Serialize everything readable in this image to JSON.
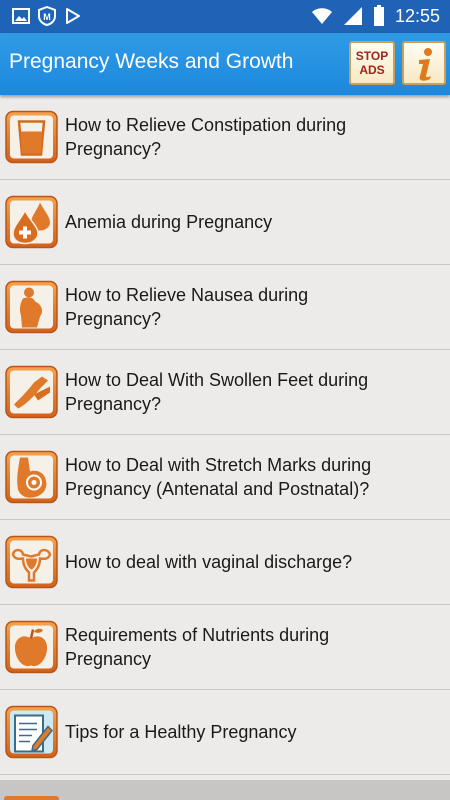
{
  "status_bar": {
    "time": "12:55",
    "left_icons": [
      "image-icon",
      "mcafee-icon",
      "play-store-icon"
    ],
    "right_icons": [
      "wifi-icon",
      "signal-icon",
      "battery-icon"
    ]
  },
  "app_bar": {
    "title": "Pregnancy Weeks and Growth",
    "stop_ads_line1": "STOP",
    "stop_ads_line2": "ADS",
    "info_icon": "info-icon"
  },
  "colors": {
    "status_bar": "#1e63b6",
    "app_bar": "#2591e0",
    "list_bg": "#ecebea",
    "icon_orange": "#e07a2a",
    "stop_ads_text": "#a3241a"
  },
  "list": {
    "items": [
      {
        "label": "How to Relieve Constipation during Pregnancy?",
        "icon": "glass-icon"
      },
      {
        "label": "Anemia during Pregnancy",
        "icon": "blood-drop-icon"
      },
      {
        "label": "How to Relieve Nausea during Pregnancy?",
        "icon": "pregnant-woman-icon"
      },
      {
        "label": "How to Deal With Swollen Feet during Pregnancy?",
        "icon": "legs-icon"
      },
      {
        "label": "How to Deal with Stretch Marks during Pregnancy (Antenatal and Postnatal)?",
        "icon": "belly-icon"
      },
      {
        "label": "How to deal with vaginal discharge?",
        "icon": "uterus-icon"
      },
      {
        "label": "Requirements of Nutrients during Pregnancy",
        "icon": "apple-icon"
      },
      {
        "label": "Tips for a Healthy Pregnancy",
        "icon": "notepad-icon"
      }
    ]
  }
}
